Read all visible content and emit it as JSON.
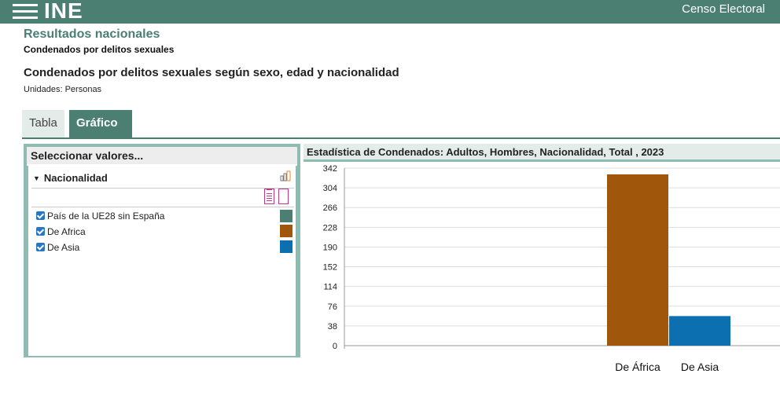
{
  "header": {
    "logo": "INE",
    "app_title": "Censo Electoral",
    "menu_icon": "hamburger-menu-icon"
  },
  "page": {
    "section_title": "Resultados nacionales",
    "section_subtitle": "Condenados por delitos sexuales",
    "table_title": "Condenados por delitos sexuales según sexo, edad y nacionalidad",
    "units": "Unidades:  Personas"
  },
  "tabs": [
    {
      "label": "Tabla",
      "active": false
    },
    {
      "label": "Gráfico",
      "active": true
    }
  ],
  "selector": {
    "header": "Seleccionar valores...",
    "variable": "Nacionalidad",
    "items": [
      {
        "label": "País de la UE28 sin España",
        "checked": true,
        "color": "#4a7f72"
      },
      {
        "label": "De Africa",
        "checked": true,
        "color": "#a0560b"
      },
      {
        "label": "De Asia",
        "checked": true,
        "color": "#0b6fb0"
      }
    ]
  },
  "chart_data": {
    "type": "bar",
    "title": "Estadística de Condenados: Adultos, Hombres, Nacionalidad, Total , 2023",
    "categories": [
      "De África",
      "De Asia"
    ],
    "values": [
      330,
      57
    ],
    "colors": [
      "#a0560b",
      "#0b6fb0"
    ],
    "yticks": [
      0,
      38,
      76,
      114,
      152,
      190,
      228,
      266,
      304,
      342
    ],
    "ylim": [
      0,
      342
    ],
    "grid": true,
    "xlabel": "",
    "ylabel": ""
  }
}
